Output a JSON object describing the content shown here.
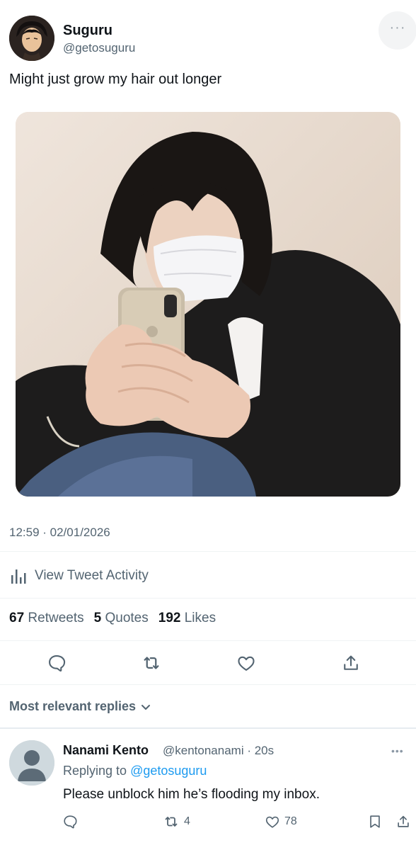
{
  "tweet": {
    "author_name": "Suguru",
    "author_handle": "@getosuguru",
    "text": "Might just grow my hair out longer",
    "timestamp": "12:59 · 02/01/2026",
    "activity_label": "View Tweet Activity",
    "stats": {
      "retweets_count": "67",
      "retweets_label": "Retweets",
      "quotes_count": "5",
      "quotes_label": "Quotes",
      "likes_count": "192",
      "likes_label": "Likes"
    },
    "actions": [
      "reply-icon",
      "retweet-icon",
      "like-icon",
      "share-icon"
    ]
  },
  "replies_sort": {
    "label": "Most relevant replies"
  },
  "reply": {
    "author_name": "Nanami Kento",
    "author_handle": "@kentonanami · 20s",
    "replying_prefix": "Replying to ",
    "replying_to": "@getosuguru",
    "text": "Please unblock him he’s flooding my inbox.",
    "retweet_count": "4",
    "like_count": "78"
  },
  "colors": {
    "text_primary": "#0f1419",
    "text_secondary": "#536471",
    "accent": "#1d9bf0"
  }
}
